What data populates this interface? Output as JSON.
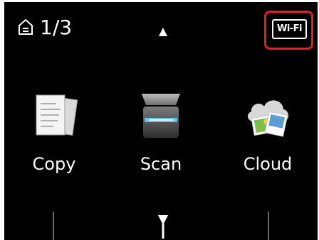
{
  "status": {
    "page_counter": "1/3",
    "wifi_badge": "Wi-Fi"
  },
  "apps": [
    {
      "label": "Copy",
      "icon": "copy-documents-icon"
    },
    {
      "label": "Scan",
      "icon": "scanner-icon"
    },
    {
      "label": "Cloud",
      "icon": "cloud-photos-icon"
    }
  ],
  "navigation": {
    "scroll_up_icon": "up-arrow-icon",
    "scroll_down_icon": "down-arrow-icon"
  },
  "colors": {
    "background": "#000000",
    "text": "#ffffff",
    "highlight": "#e31e24"
  }
}
